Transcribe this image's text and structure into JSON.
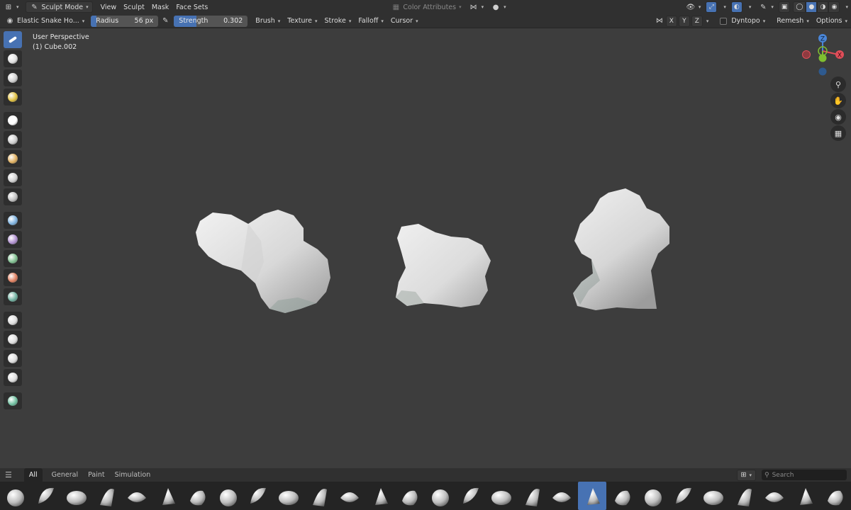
{
  "header": {
    "mode_label": "Sculpt Mode",
    "menus": [
      "View",
      "Sculpt",
      "Mask",
      "Face Sets"
    ],
    "color_attributes": "Color Attributes"
  },
  "tool_settings": {
    "brush_name": "Elastic Snake Ho...",
    "radius_label": "Radius",
    "radius_value": "56 px",
    "strength_label": "Strength",
    "strength_value": "0.302",
    "strength_fraction": 0.302,
    "dropdowns": [
      "Brush",
      "Texture",
      "Stroke",
      "Falloff",
      "Cursor"
    ],
    "axes": [
      "X",
      "Y",
      "Z"
    ],
    "dyntopo_label": "Dyntopo",
    "remesh_label": "Remesh",
    "options_label": "Options"
  },
  "viewport": {
    "perspective_label": "User Perspective",
    "object_label": "(1) Cube.002"
  },
  "gizmo": {
    "z": "Z",
    "x": "X"
  },
  "toolbar": {
    "tools": [
      {
        "name": "draw-brush-tool",
        "color": "#ffffff",
        "active": true
      },
      {
        "name": "smear-tool",
        "color": "#e0e0e0"
      },
      {
        "name": "grab-tool",
        "color": "#d0d0d0"
      },
      {
        "name": "paint-tool",
        "color": "#e0c040"
      },
      {
        "name": "mask-tool",
        "color": "#ffffff"
      },
      {
        "name": "box-mask-tool",
        "color": "#cccccc"
      },
      {
        "name": "box-hide-tool",
        "color": "#e0b060"
      },
      {
        "name": "box-face-set-tool",
        "color": "#d0d0d0"
      },
      {
        "name": "box-trim-tool",
        "color": "#c0c0c0"
      },
      {
        "name": "line-project-tool",
        "color": "#7fb3e0"
      },
      {
        "name": "mesh-filter-tool",
        "color": "#b090d0"
      },
      {
        "name": "cloth-filter-tool",
        "color": "#80c090"
      },
      {
        "name": "color-filter-tool",
        "color": "#e08060"
      },
      {
        "name": "edit-face-set-tool",
        "color": "#70b0a0"
      },
      {
        "name": "move-tool",
        "color": "#dddddd"
      },
      {
        "name": "rotate-tool",
        "color": "#dddddd"
      },
      {
        "name": "scale-tool",
        "color": "#dddddd"
      },
      {
        "name": "transform-tool",
        "color": "#dddddd"
      },
      {
        "name": "annotate-tool",
        "color": "#70c0a0"
      }
    ]
  },
  "shelf": {
    "tabs": [
      "All",
      "General",
      "Paint",
      "Simulation"
    ],
    "search_placeholder": "Search",
    "brush_count": 28,
    "active_index": 19
  },
  "colors": {
    "accent": "#4772b3",
    "viewport_bg": "#3d3d3d",
    "header_bg": "#303030",
    "gizmo_x": "#e04e59",
    "gizmo_y": "#7fbf30",
    "gizmo_z": "#4a86d8"
  }
}
